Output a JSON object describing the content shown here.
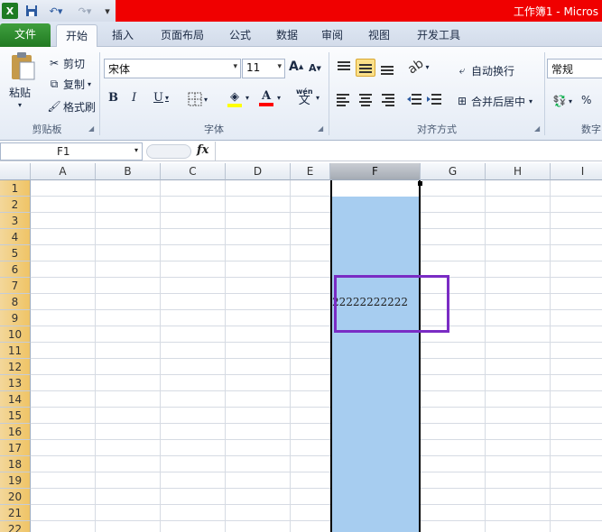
{
  "titlebar": {
    "title": "工作簿1 - Micros"
  },
  "tabs": [
    "文件",
    "开始",
    "插入",
    "页面布局",
    "公式",
    "数据",
    "审阅",
    "视图",
    "开发工具"
  ],
  "clipboard": {
    "paste": "粘贴",
    "cut": "剪切",
    "copy": "复制",
    "format_painter": "格式刷",
    "group": "剪贴板"
  },
  "font": {
    "name": "宋体",
    "size": "11",
    "grow": "A",
    "shrink": "A",
    "bold": "B",
    "italic": "I",
    "underline": "U",
    "phonetic": "wén",
    "phonetic_char": "文",
    "group": "字体"
  },
  "alignment": {
    "wrap": "自动换行",
    "merge": "合并后居中",
    "group": "对齐方式"
  },
  "number": {
    "format": "常规",
    "percent": "%",
    "group": "数字"
  },
  "formula_bar": {
    "cell": "F1",
    "fx": "fx",
    "content": ""
  },
  "sheet": {
    "columns": [
      "A",
      "B",
      "C",
      "D",
      "E",
      "F",
      "G",
      "H",
      "I"
    ],
    "rows": [
      "1",
      "2",
      "3",
      "4",
      "5",
      "6",
      "7",
      "8",
      "9",
      "10",
      "11",
      "12",
      "13",
      "14",
      "15",
      "16",
      "17",
      "18",
      "19",
      "20",
      "21",
      "22"
    ],
    "selected_column": "F",
    "cell_F8": "22222222222"
  },
  "colors": {
    "selection": "#a7cdf0",
    "highlight_box": "#7a2cc4",
    "file_tab": "#2b8a2c",
    "title_red": "#f00000"
  }
}
